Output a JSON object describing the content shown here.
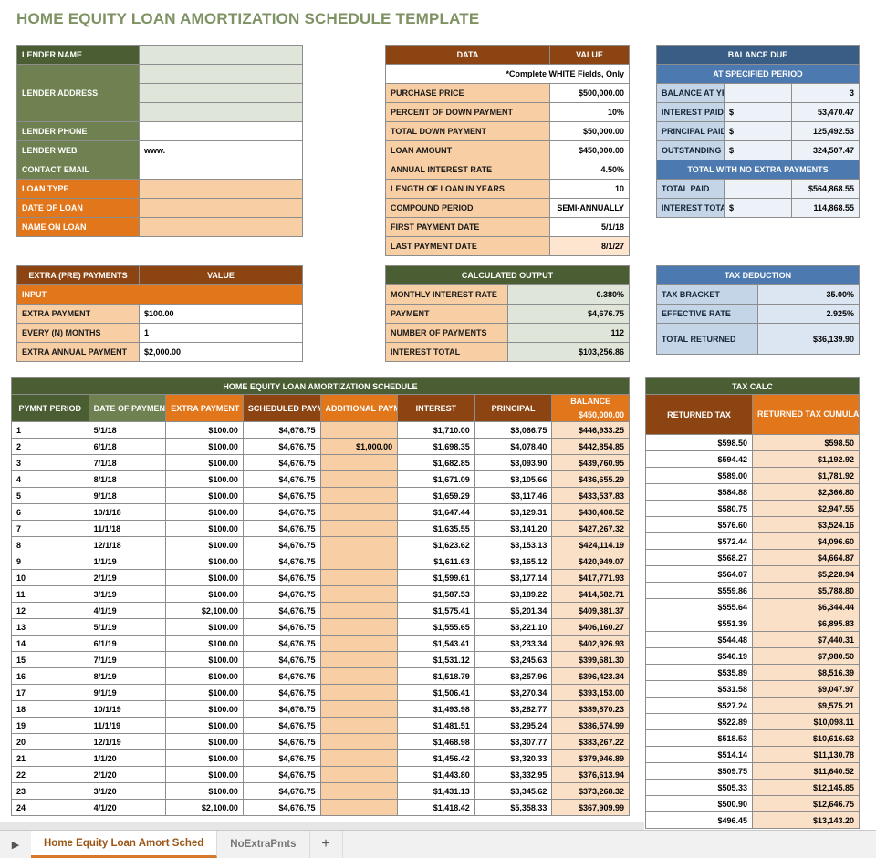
{
  "title": "HOME EQUITY LOAN AMORTIZATION SCHEDULE TEMPLATE",
  "colors": {
    "title": "#7e9263",
    "green_dark": "#4b5d32",
    "green": "#6f8150",
    "orange": "#e2761b",
    "brown": "#8c4512",
    "blue_dark": "#3a5d86",
    "blue": "#4c7ab0",
    "peach": "#f8cfa4"
  },
  "lender": {
    "rows": [
      {
        "label": "LENDER NAME",
        "value": ""
      },
      {
        "label": "LENDER ADDRESS",
        "value": ""
      },
      {
        "label": "",
        "value": ""
      },
      {
        "label": "",
        "value": ""
      },
      {
        "label": "LENDER PHONE",
        "value": ""
      },
      {
        "label": "LENDER WEB",
        "value": "www."
      },
      {
        "label": "CONTACT EMAIL",
        "value": ""
      },
      {
        "label": "LOAN TYPE",
        "value": ""
      },
      {
        "label": "DATE OF LOAN",
        "value": ""
      },
      {
        "label": "NAME ON LOAN",
        "value": ""
      }
    ]
  },
  "extra_payments": {
    "header_label": "EXTRA (PRE) PAYMENTS",
    "header_value": "VALUE",
    "subheader": "INPUT",
    "rows": [
      {
        "label": "EXTRA PAYMENT",
        "value": "$100.00"
      },
      {
        "label": "EVERY (N) MONTHS",
        "value": "1"
      },
      {
        "label": "EXTRA ANNUAL PAYMENT",
        "value": "$2,000.00"
      }
    ]
  },
  "data_block": {
    "header_label": "DATA",
    "header_value": "VALUE",
    "note": "*Complete WHITE Fields, Only",
    "rows": [
      {
        "label": "PURCHASE PRICE",
        "value": "$500,000.00"
      },
      {
        "label": "PERCENT OF DOWN PAYMENT",
        "value": "10%"
      },
      {
        "label": "TOTAL DOWN PAYMENT",
        "value": "$50,000.00"
      },
      {
        "label": "LOAN AMOUNT",
        "value": "$450,000.00"
      },
      {
        "label": "ANNUAL INTEREST RATE",
        "value": "4.50%"
      },
      {
        "label": "LENGTH OF LOAN IN YEARS",
        "value": "10"
      },
      {
        "label": "COMPOUND PERIOD",
        "value": "SEMI-ANNUALLY"
      },
      {
        "label": "FIRST PAYMENT DATE",
        "value": "5/1/18"
      },
      {
        "label": "LAST PAYMENT DATE",
        "value": "8/1/27"
      }
    ]
  },
  "calculated_output": {
    "header": "CALCULATED OUTPUT",
    "rows": [
      {
        "label": "MONTHLY INTEREST RATE",
        "value": "0.380%"
      },
      {
        "label": "PAYMENT",
        "value": "$4,676.75"
      },
      {
        "label": "NUMBER OF PAYMENTS",
        "value": "112"
      },
      {
        "label": "INTEREST TOTAL",
        "value": "$103,256.86"
      }
    ]
  },
  "balance_due": {
    "header": "BALANCE DUE",
    "subheader": "AT SPECIFIED PERIOD",
    "rows": [
      {
        "label": "BALANCE AT YR",
        "currency": "",
        "value": "3"
      },
      {
        "label": "INTEREST PAID",
        "currency": "$",
        "value": "53,470.47"
      },
      {
        "label": "PRINCIPAL PAID",
        "currency": "$",
        "value": "125,492.53"
      },
      {
        "label": "OUTSTANDING",
        "currency": "$",
        "value": "324,507.47"
      }
    ],
    "totals_header": "TOTAL WITH NO EXTRA PAYMENTS",
    "totals": [
      {
        "label": "TOTAL PAID",
        "currency": "",
        "value": "$564,868.55"
      },
      {
        "label": "INTEREST TOTAL",
        "currency": "$",
        "value": "114,868.55"
      }
    ]
  },
  "tax_deduction": {
    "header": "TAX DEDUCTION",
    "rows": [
      {
        "label": "TAX BRACKET",
        "value": "35.00%"
      },
      {
        "label": "EFFECTIVE RATE",
        "value": "2.925%"
      },
      {
        "label": "TOTAL RETURNED",
        "value": "$36,139.90"
      }
    ]
  },
  "amortization": {
    "title": "HOME EQUITY LOAN AMORTIZATION SCHEDULE",
    "columns": [
      "PYMNT PERIOD",
      "DATE OF PAYMENT",
      "EXTRA PAYMENT",
      "SCHEDULED PAYMENT",
      "ADDITIONAL PAYMENT",
      "INTEREST",
      "PRINCIPAL",
      "BALANCE"
    ],
    "balance_start": "$450,000.00",
    "rows": [
      {
        "period": "1",
        "date": "5/1/18",
        "extra": "$100.00",
        "scheduled": "$4,676.75",
        "additional": "",
        "interest": "$1,710.00",
        "principal": "$3,066.75",
        "balance": "$446,933.25"
      },
      {
        "period": "2",
        "date": "6/1/18",
        "extra": "$100.00",
        "scheduled": "$4,676.75",
        "additional": "$1,000.00",
        "interest": "$1,698.35",
        "principal": "$4,078.40",
        "balance": "$442,854.85"
      },
      {
        "period": "3",
        "date": "7/1/18",
        "extra": "$100.00",
        "scheduled": "$4,676.75",
        "additional": "",
        "interest": "$1,682.85",
        "principal": "$3,093.90",
        "balance": "$439,760.95"
      },
      {
        "period": "4",
        "date": "8/1/18",
        "extra": "$100.00",
        "scheduled": "$4,676.75",
        "additional": "",
        "interest": "$1,671.09",
        "principal": "$3,105.66",
        "balance": "$436,655.29"
      },
      {
        "period": "5",
        "date": "9/1/18",
        "extra": "$100.00",
        "scheduled": "$4,676.75",
        "additional": "",
        "interest": "$1,659.29",
        "principal": "$3,117.46",
        "balance": "$433,537.83"
      },
      {
        "period": "6",
        "date": "10/1/18",
        "extra": "$100.00",
        "scheduled": "$4,676.75",
        "additional": "",
        "interest": "$1,647.44",
        "principal": "$3,129.31",
        "balance": "$430,408.52"
      },
      {
        "period": "7",
        "date": "11/1/18",
        "extra": "$100.00",
        "scheduled": "$4,676.75",
        "additional": "",
        "interest": "$1,635.55",
        "principal": "$3,141.20",
        "balance": "$427,267.32"
      },
      {
        "period": "8",
        "date": "12/1/18",
        "extra": "$100.00",
        "scheduled": "$4,676.75",
        "additional": "",
        "interest": "$1,623.62",
        "principal": "$3,153.13",
        "balance": "$424,114.19"
      },
      {
        "period": "9",
        "date": "1/1/19",
        "extra": "$100.00",
        "scheduled": "$4,676.75",
        "additional": "",
        "interest": "$1,611.63",
        "principal": "$3,165.12",
        "balance": "$420,949.07"
      },
      {
        "period": "10",
        "date": "2/1/19",
        "extra": "$100.00",
        "scheduled": "$4,676.75",
        "additional": "",
        "interest": "$1,599.61",
        "principal": "$3,177.14",
        "balance": "$417,771.93"
      },
      {
        "period": "11",
        "date": "3/1/19",
        "extra": "$100.00",
        "scheduled": "$4,676.75",
        "additional": "",
        "interest": "$1,587.53",
        "principal": "$3,189.22",
        "balance": "$414,582.71"
      },
      {
        "period": "12",
        "date": "4/1/19",
        "extra": "$2,100.00",
        "scheduled": "$4,676.75",
        "additional": "",
        "interest": "$1,575.41",
        "principal": "$5,201.34",
        "balance": "$409,381.37"
      },
      {
        "period": "13",
        "date": "5/1/19",
        "extra": "$100.00",
        "scheduled": "$4,676.75",
        "additional": "",
        "interest": "$1,555.65",
        "principal": "$3,221.10",
        "balance": "$406,160.27"
      },
      {
        "period": "14",
        "date": "6/1/19",
        "extra": "$100.00",
        "scheduled": "$4,676.75",
        "additional": "",
        "interest": "$1,543.41",
        "principal": "$3,233.34",
        "balance": "$402,926.93"
      },
      {
        "period": "15",
        "date": "7/1/19",
        "extra": "$100.00",
        "scheduled": "$4,676.75",
        "additional": "",
        "interest": "$1,531.12",
        "principal": "$3,245.63",
        "balance": "$399,681.30"
      },
      {
        "period": "16",
        "date": "8/1/19",
        "extra": "$100.00",
        "scheduled": "$4,676.75",
        "additional": "",
        "interest": "$1,518.79",
        "principal": "$3,257.96",
        "balance": "$396,423.34"
      },
      {
        "period": "17",
        "date": "9/1/19",
        "extra": "$100.00",
        "scheduled": "$4,676.75",
        "additional": "",
        "interest": "$1,506.41",
        "principal": "$3,270.34",
        "balance": "$393,153.00"
      },
      {
        "period": "18",
        "date": "10/1/19",
        "extra": "$100.00",
        "scheduled": "$4,676.75",
        "additional": "",
        "interest": "$1,493.98",
        "principal": "$3,282.77",
        "balance": "$389,870.23"
      },
      {
        "period": "19",
        "date": "11/1/19",
        "extra": "$100.00",
        "scheduled": "$4,676.75",
        "additional": "",
        "interest": "$1,481.51",
        "principal": "$3,295.24",
        "balance": "$386,574.99"
      },
      {
        "period": "20",
        "date": "12/1/19",
        "extra": "$100.00",
        "scheduled": "$4,676.75",
        "additional": "",
        "interest": "$1,468.98",
        "principal": "$3,307.77",
        "balance": "$383,267.22"
      },
      {
        "period": "21",
        "date": "1/1/20",
        "extra": "$100.00",
        "scheduled": "$4,676.75",
        "additional": "",
        "interest": "$1,456.42",
        "principal": "$3,320.33",
        "balance": "$379,946.89"
      },
      {
        "period": "22",
        "date": "2/1/20",
        "extra": "$100.00",
        "scheduled": "$4,676.75",
        "additional": "",
        "interest": "$1,443.80",
        "principal": "$3,332.95",
        "balance": "$376,613.94"
      },
      {
        "period": "23",
        "date": "3/1/20",
        "extra": "$100.00",
        "scheduled": "$4,676.75",
        "additional": "",
        "interest": "$1,431.13",
        "principal": "$3,345.62",
        "balance": "$373,268.32"
      },
      {
        "period": "24",
        "date": "4/1/20",
        "extra": "$2,100.00",
        "scheduled": "$4,676.75",
        "additional": "",
        "interest": "$1,418.42",
        "principal": "$5,358.33",
        "balance": "$367,909.99"
      }
    ]
  },
  "tax_calc": {
    "title": "TAX CALC",
    "columns": [
      "RETURNED TAX",
      "RETURNED TAX CUMULATIVE"
    ],
    "rows": [
      {
        "returned": "$598.50",
        "cumulative": "$598.50"
      },
      {
        "returned": "$594.42",
        "cumulative": "$1,192.92"
      },
      {
        "returned": "$589.00",
        "cumulative": "$1,781.92"
      },
      {
        "returned": "$584.88",
        "cumulative": "$2,366.80"
      },
      {
        "returned": "$580.75",
        "cumulative": "$2,947.55"
      },
      {
        "returned": "$576.60",
        "cumulative": "$3,524.16"
      },
      {
        "returned": "$572.44",
        "cumulative": "$4,096.60"
      },
      {
        "returned": "$568.27",
        "cumulative": "$4,664.87"
      },
      {
        "returned": "$564.07",
        "cumulative": "$5,228.94"
      },
      {
        "returned": "$559.86",
        "cumulative": "$5,788.80"
      },
      {
        "returned": "$555.64",
        "cumulative": "$6,344.44"
      },
      {
        "returned": "$551.39",
        "cumulative": "$6,895.83"
      },
      {
        "returned": "$544.48",
        "cumulative": "$7,440.31"
      },
      {
        "returned": "$540.19",
        "cumulative": "$7,980.50"
      },
      {
        "returned": "$535.89",
        "cumulative": "$8,516.39"
      },
      {
        "returned": "$531.58",
        "cumulative": "$9,047.97"
      },
      {
        "returned": "$527.24",
        "cumulative": "$9,575.21"
      },
      {
        "returned": "$522.89",
        "cumulative": "$10,098.11"
      },
      {
        "returned": "$518.53",
        "cumulative": "$10,616.63"
      },
      {
        "returned": "$514.14",
        "cumulative": "$11,130.78"
      },
      {
        "returned": "$509.75",
        "cumulative": "$11,640.52"
      },
      {
        "returned": "$505.33",
        "cumulative": "$12,145.85"
      },
      {
        "returned": "$500.90",
        "cumulative": "$12,646.75"
      },
      {
        "returned": "$496.45",
        "cumulative": "$13,143.20"
      }
    ]
  },
  "tabbar": {
    "scroll_arrow": "▶",
    "tabs": [
      {
        "label": "Home Equity Loan Amort Sched",
        "active": true
      },
      {
        "label": "NoExtraPmts",
        "active": false
      }
    ],
    "add_tab": "+"
  }
}
